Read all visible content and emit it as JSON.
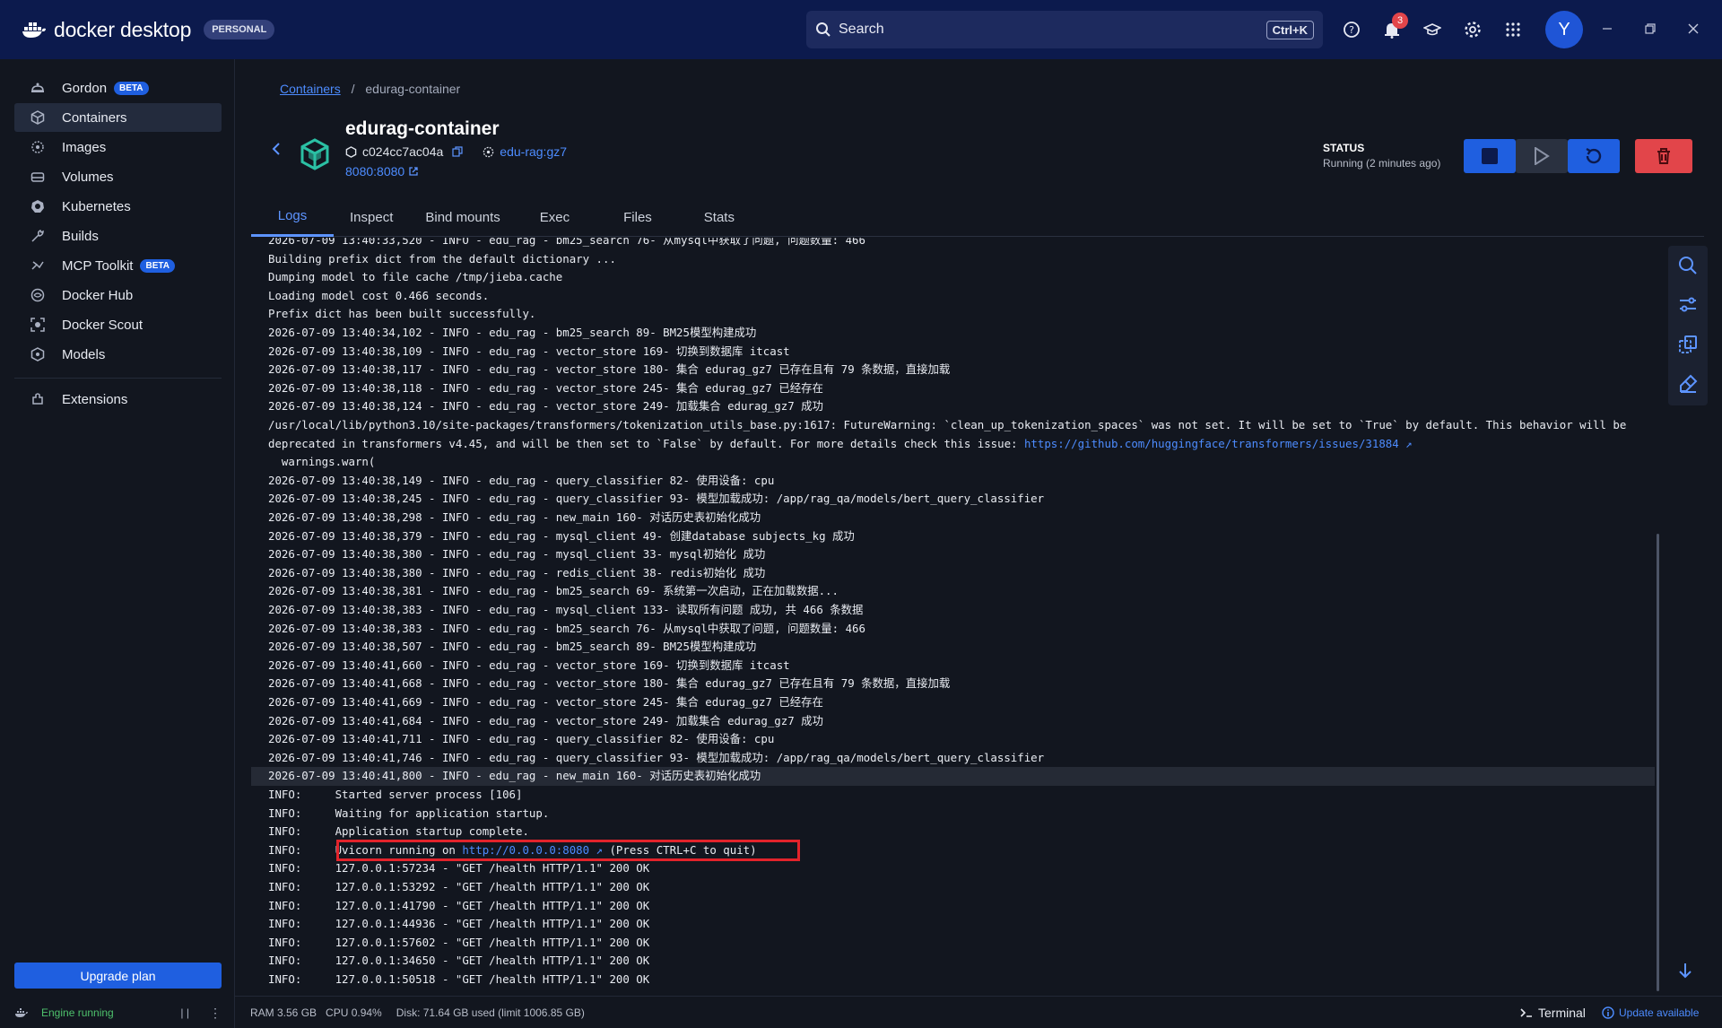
{
  "app": {
    "name": "docker desktop",
    "plan_badge": "PERSONAL"
  },
  "search": {
    "placeholder": "Search",
    "shortcut": "Ctrl+K"
  },
  "notifications": {
    "count": "3"
  },
  "user": {
    "initial": "Y"
  },
  "sidebar": {
    "items": [
      {
        "label": "Gordon",
        "icon": "gordon-icon",
        "beta": "BETA"
      },
      {
        "label": "Containers",
        "icon": "container-icon",
        "active": true
      },
      {
        "label": "Images",
        "icon": "image-icon"
      },
      {
        "label": "Volumes",
        "icon": "volume-icon"
      },
      {
        "label": "Kubernetes",
        "icon": "kubernetes-icon"
      },
      {
        "label": "Builds",
        "icon": "build-icon"
      },
      {
        "label": "MCP Toolkit",
        "icon": "mcp-icon",
        "beta": "BETA"
      },
      {
        "label": "Docker Hub",
        "icon": "hub-icon"
      },
      {
        "label": "Docker Scout",
        "icon": "scout-icon"
      },
      {
        "label": "Models",
        "icon": "models-icon"
      }
    ],
    "extensions_label": "Extensions",
    "upgrade_label": "Upgrade plan",
    "engine_status": "Engine running"
  },
  "breadcrumb": {
    "parent": "Containers",
    "separator": "/",
    "current": "edurag-container"
  },
  "container": {
    "name": "edurag-container",
    "id": "c024cc7ac04a",
    "image": "edu-rag:gz7",
    "port": "8080:8080",
    "status_label": "STATUS",
    "status_value": "Running (2 minutes ago)"
  },
  "tabs": [
    "Logs",
    "Inspect",
    "Bind mounts",
    "Exec",
    "Files",
    "Stats"
  ],
  "logs": [
    "2026-07-09 13:40:33,520 - INFO - edu_rag - bm25_search 76- 从mysql中获取了问题, 问题数量: 466",
    "Building prefix dict from the default dictionary ...",
    "Dumping model to file cache /tmp/jieba.cache",
    "Loading model cost 0.466 seconds.",
    "Prefix dict has been built successfully.",
    "2026-07-09 13:40:34,102 - INFO - edu_rag - bm25_search 89- BM25模型构建成功",
    "2026-07-09 13:40:38,109 - INFO - edu_rag - vector_store 169- 切换到数据库 itcast",
    "2026-07-09 13:40:38,117 - INFO - edu_rag - vector_store 180- 集合 edurag_gz7 已存在且有 79 条数据，直接加载",
    "2026-07-09 13:40:38,118 - INFO - edu_rag - vector_store 245- 集合 edurag_gz7 已经存在",
    "2026-07-09 13:40:38,124 - INFO - edu_rag - vector_store 249- 加载集合 edurag_gz7 成功",
    "/usr/local/lib/python3.10/site-packages/transformers/tokenization_utils_base.py:1617: FutureWarning: `clean_up_tokenization_spaces` was not set. It will be set to `True` by default. This behavior will be",
    "deprecated in transformers v4.45, and will be then set to `False` by default. For more details check this issue: ",
    "  warnings.warn(",
    "2026-07-09 13:40:38,149 - INFO - edu_rag - query_classifier 82- 使用设备: cpu",
    "2026-07-09 13:40:38,245 - INFO - edu_rag - query_classifier 93- 模型加载成功: /app/rag_qa/models/bert_query_classifier",
    "2026-07-09 13:40:38,298 - INFO - edu_rag - new_main 160- 对话历史表初始化成功",
    "2026-07-09 13:40:38,379 - INFO - edu_rag - mysql_client 49- 创建database subjects_kg 成功",
    "2026-07-09 13:40:38,380 - INFO - edu_rag - mysql_client 33- mysql初始化 成功",
    "2026-07-09 13:40:38,380 - INFO - edu_rag - redis_client 38- redis初始化 成功",
    "2026-07-09 13:40:38,381 - INFO - edu_rag - bm25_search 69- 系统第一次启动，正在加载数据...",
    "2026-07-09 13:40:38,383 - INFO - edu_rag - mysql_client 133- 读取所有问题 成功, 共 466 条数据",
    "2026-07-09 13:40:38,383 - INFO - edu_rag - bm25_search 76- 从mysql中获取了问题, 问题数量: 466",
    "2026-07-09 13:40:38,507 - INFO - edu_rag - bm25_search 89- BM25模型构建成功",
    "2026-07-09 13:40:41,660 - INFO - edu_rag - vector_store 169- 切换到数据库 itcast",
    "2026-07-09 13:40:41,668 - INFO - edu_rag - vector_store 180- 集合 edurag_gz7 已存在且有 79 条数据，直接加载",
    "2026-07-09 13:40:41,669 - INFO - edu_rag - vector_store 245- 集合 edurag_gz7 已经存在",
    "2026-07-09 13:40:41,684 - INFO - edu_rag - vector_store 249- 加载集合 edurag_gz7 成功",
    "2026-07-09 13:40:41,711 - INFO - edu_rag - query_classifier 82- 使用设备: cpu",
    "2026-07-09 13:40:41,746 - INFO - edu_rag - query_classifier 93- 模型加载成功: /app/rag_qa/models/bert_query_classifier",
    "2026-07-09 13:40:41,800 - INFO - edu_rag - new_main 160- 对话历史表初始化成功",
    "INFO:     Started server process [106]",
    "INFO:     Waiting for application startup.",
    "INFO:     Application startup complete.",
    "INFO:     Uvicorn running on ",
    "INFO:     127.0.0.1:57234 - \"GET /health HTTP/1.1\" 200 OK",
    "INFO:     127.0.0.1:53292 - \"GET /health HTTP/1.1\" 200 OK",
    "INFO:     127.0.0.1:41790 - \"GET /health HTTP/1.1\" 200 OK",
    "INFO:     127.0.0.1:44936 - \"GET /health HTTP/1.1\" 200 OK",
    "INFO:     127.0.0.1:57602 - \"GET /health HTTP/1.1\" 200 OK",
    "INFO:     127.0.0.1:34650 - \"GET /health HTTP/1.1\" 200 OK",
    "INFO:     127.0.0.1:50518 - \"GET /health HTTP/1.1\" 200 OK"
  ],
  "log_links": {
    "issue_url": "https://github.com/huggingface/transformers/issues/31884",
    "uvicorn_url": "http://0.0.0.0:8080",
    "uvicorn_suffix": " (Press CTRL+C to quit)"
  },
  "footer": {
    "ram": "RAM 3.56 GB",
    "cpu": "CPU 0.94%",
    "disk": "Disk: 71.64 GB used (limit 1006.85 GB)",
    "terminal": "Terminal",
    "update": "Update available"
  },
  "colors": {
    "topbar": "#0c1a4d",
    "accent": "#1f5fe0",
    "danger": "#e2454a",
    "highlight_box": "#e2232b"
  }
}
